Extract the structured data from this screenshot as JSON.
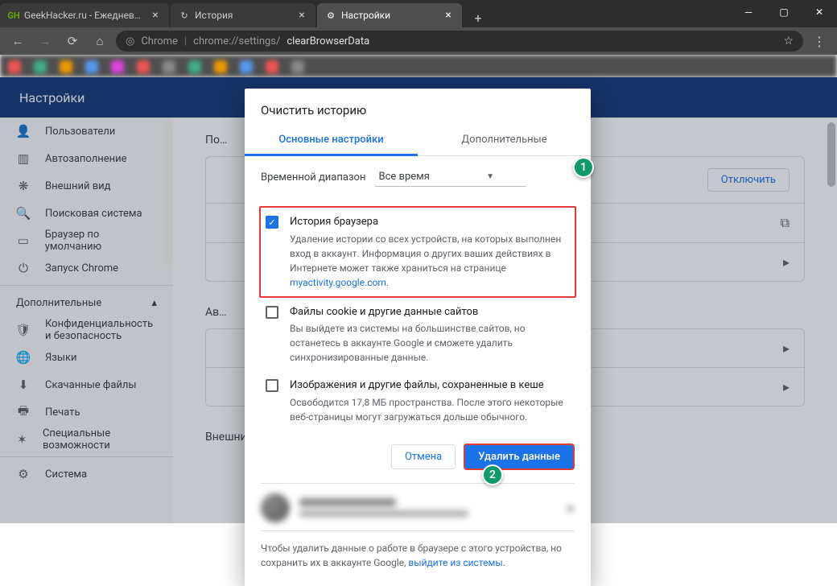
{
  "window": {
    "tabs": [
      {
        "label": "GeekHacker.ru - Ежедневный ж",
        "favicon_color": "#6a0"
      },
      {
        "label": "История",
        "favicon": "↻"
      },
      {
        "label": "Настройки",
        "favicon": "⚙"
      }
    ]
  },
  "addr": {
    "secure": "Chrome",
    "sep": "|",
    "url_prefix": "chrome://settings/",
    "url_page": "clearBrowserData"
  },
  "header": {
    "title": "Настройки"
  },
  "sidebar": {
    "items": [
      {
        "icon": "👤",
        "label": "Пользователи"
      },
      {
        "icon": "▥",
        "label": "Автозаполнение"
      },
      {
        "icon": "❋",
        "label": "Внешний вид"
      },
      {
        "icon": "🔍",
        "label": "Поисковая система"
      },
      {
        "icon": "▭",
        "label": "Браузер по умолчанию"
      },
      {
        "icon": "⏻",
        "label": "Запуск Chrome"
      }
    ],
    "group": "Дополнительные",
    "items2": [
      {
        "icon": "🛡",
        "label": "Конфиденциальность и безопасность"
      },
      {
        "icon": "🌐",
        "label": "Языки"
      },
      {
        "icon": "⬇",
        "label": "Скачанные файлы"
      },
      {
        "icon": "🖶",
        "label": "Печать"
      },
      {
        "icon": "✶",
        "label": "Специальные возможности"
      },
      {
        "icon": "⚙",
        "label": "Система"
      }
    ]
  },
  "main": {
    "sec1": "По…",
    "disable_btn": "Отключить",
    "sec2": "Ав…",
    "sec3": "Внешний вид"
  },
  "dialog": {
    "title": "Очистить историю",
    "tab_basic": "Основные настройки",
    "tab_adv": "Дополнительные",
    "range_label": "Временной диапазон",
    "range_value": "Все время",
    "opt1_title": "История браузера",
    "opt1_desc1": "Удаление истории со всех устройств, на которых выполнен вход в аккаунт. Информация о других ваших действиях в Интернете может также храниться на странице ",
    "opt1_link": "myactivity.google.com",
    "opt1_dot": ".",
    "opt2_title": "Файлы cookie и другие данные сайтов",
    "opt2_desc": "Вы выйдете из системы на большинстве сайтов, но останетесь в аккаунте Google и сможете удалить синхронизированные данные.",
    "opt3_title": "Изображения и другие файлы, сохраненные в кеше",
    "opt3_desc": "Освободится 17,8 МБ пространства. После этого некоторые веб-страницы могут загружаться дольше обычного.",
    "cancel": "Отмена",
    "confirm": "Удалить данные",
    "foot_text1": "Чтобы удалить данные о работе в браузере с этого устройства, но сохранить их в аккаунте Google, ",
    "foot_link": "выйдите из системы",
    "foot_dot": "."
  },
  "callouts": {
    "c1": "1",
    "c2": "2"
  }
}
